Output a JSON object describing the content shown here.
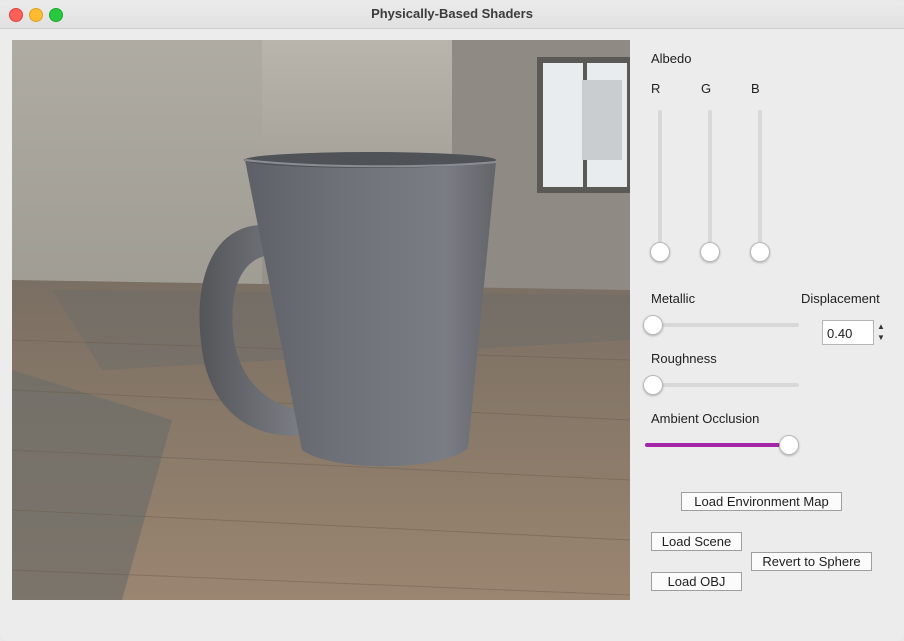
{
  "window": {
    "title": "Physically-Based Shaders"
  },
  "controls": {
    "albedo": {
      "label": "Albedo",
      "r_label": "R",
      "g_label": "G",
      "b_label": "B",
      "r": 0.0,
      "g": 0.0,
      "b": 0.0
    },
    "metallic": {
      "label": "Metallic",
      "value": 0.0
    },
    "displacement": {
      "label": "Displacement",
      "value": "0.40"
    },
    "roughness": {
      "label": "Roughness",
      "value": 0.0
    },
    "ambient_occlusion": {
      "label": "Ambient Occlusion",
      "value": 1.0
    }
  },
  "buttons": {
    "load_env_map": "Load Environment Map",
    "load_scene": "Load Scene",
    "revert_sphere": "Revert to Sphere",
    "load_obj": "Load OBJ"
  },
  "colors": {
    "accent": "#a425a8"
  },
  "icons": {
    "stepper_up": "▲",
    "stepper_down": "▼"
  }
}
